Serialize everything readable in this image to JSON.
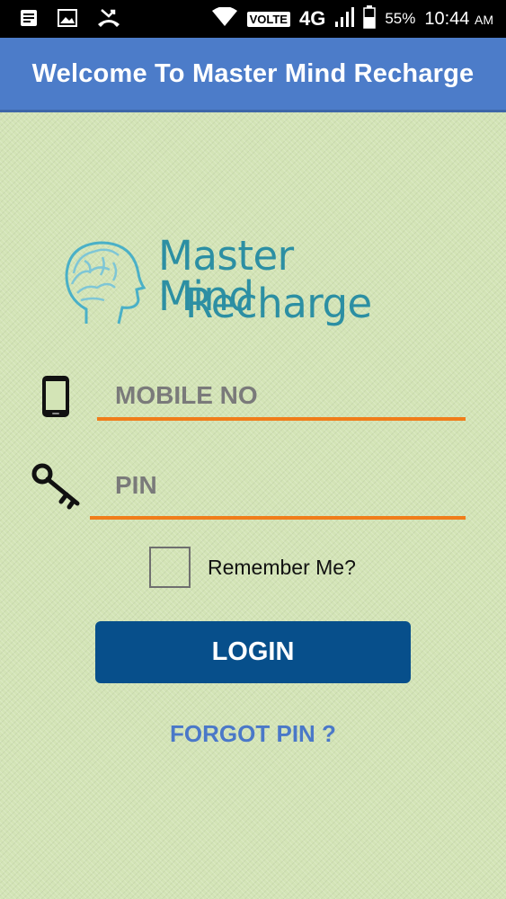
{
  "status_bar": {
    "icons": [
      "notes-icon",
      "image-icon",
      "missed-call-icon",
      "wifi-icon",
      "signal-icon",
      "battery-icon"
    ],
    "volte": "VOLTE",
    "network": "4G",
    "battery_percent": "55%",
    "time": "10:44",
    "ampm": "AM"
  },
  "app_bar": {
    "title": "Welcome To Master Mind Recharge",
    "color": "#4c7cc9"
  },
  "logo": {
    "line1": "Master Mind",
    "line2": "Recharge",
    "icon": "brain-head-icon"
  },
  "form": {
    "mobile_placeholder": "MOBILE NO",
    "mobile_value": "",
    "mobile_icon": "phone-icon",
    "pin_placeholder": "PIN",
    "pin_value": "",
    "pin_icon": "key-icon",
    "remember_label": "Remember Me?",
    "remember_checked": false,
    "underline_color": "#f07d1a"
  },
  "actions": {
    "login_label": "LOGIN",
    "forgot_label": "FORGOT PIN ?",
    "login_color": "#074f8b"
  }
}
